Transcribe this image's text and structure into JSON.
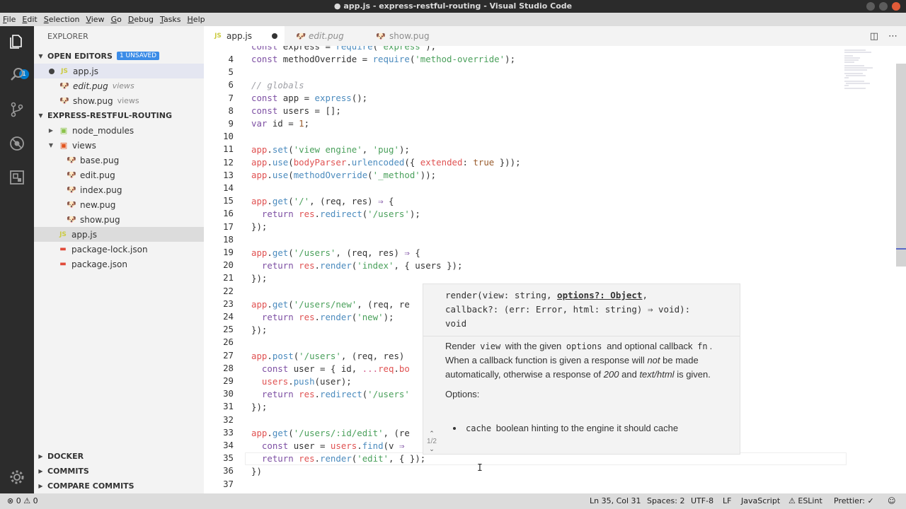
{
  "window": {
    "title": "● app.js - express-restful-routing - Visual Studio Code"
  },
  "menu": [
    "File",
    "Edit",
    "Selection",
    "View",
    "Go",
    "Debug",
    "Tasks",
    "Help"
  ],
  "activity": {
    "explorer_badge": "1"
  },
  "sidebar": {
    "title": "EXPLORER",
    "open_editors": {
      "label": "OPEN EDITORS",
      "badge": "1 UNSAVED",
      "items": [
        {
          "icon": "JS",
          "name": "app.js",
          "desc": ""
        },
        {
          "icon": "pug",
          "name": "edit.pug",
          "desc": "views"
        },
        {
          "icon": "pug",
          "name": "show.pug",
          "desc": "views"
        }
      ]
    },
    "project": {
      "label": "EXPRESS-RESTFUL-ROUTING",
      "node_modules": "node_modules",
      "views": "views",
      "view_files": [
        "base.pug",
        "edit.pug",
        "index.pug",
        "new.pug",
        "show.pug"
      ],
      "root_files": [
        "app.js",
        "package-lock.json",
        "package.json"
      ]
    },
    "bottom_sections": [
      "DOCKER",
      "COMMITS",
      "COMPARE COMMITS"
    ]
  },
  "tabs": [
    {
      "label": "app.js",
      "icon": "JS"
    },
    {
      "label": "edit.pug"
    },
    {
      "label": "show.pug"
    }
  ],
  "editor": {
    "line_numbers": [
      "4",
      "5",
      "6",
      "7",
      "8",
      "9",
      "10",
      "11",
      "12",
      "13",
      "14",
      "15",
      "16",
      "17",
      "18",
      "19",
      "20",
      "21",
      "22",
      "23",
      "24",
      "25",
      "26",
      "27",
      "28",
      "29",
      "30",
      "31",
      "32",
      "33",
      "34",
      "35",
      "36",
      "37"
    ]
  },
  "hover": {
    "sig_name": "render(view: string, ",
    "sig_active": "options?: Object",
    "sig_rest1": ",",
    "sig_line2": "callback?: (err: Error, html: string) ⇒ void):",
    "sig_line3": "void",
    "doc_render": "Render",
    "doc_view": "view",
    "doc_with": "with the given",
    "doc_options": "options",
    "doc_and": "and optional callback",
    "doc_fn": "fn",
    "doc_p2a": "When a callback function is given a response will",
    "doc_not": "not",
    "doc_p2b": "be made automatically, otherwise a response of",
    "doc_200": "200",
    "doc_and2": "and",
    "doc_texthtml": "text/html",
    "doc_p2c": "is given.",
    "doc_options_heading": "Options:",
    "doc_bullet_code": "cache",
    "doc_bullet_text": "boolean hinting to the engine it should cache",
    "overload": "1/2"
  },
  "status": {
    "errors": "0",
    "warnings": "0",
    "position": "Ln 35, Col 31",
    "spaces": "Spaces: 2",
    "encoding": "UTF-8",
    "eol": "LF",
    "language": "JavaScript",
    "eslint": "ESLint",
    "prettier": "Prettier: ✓"
  }
}
